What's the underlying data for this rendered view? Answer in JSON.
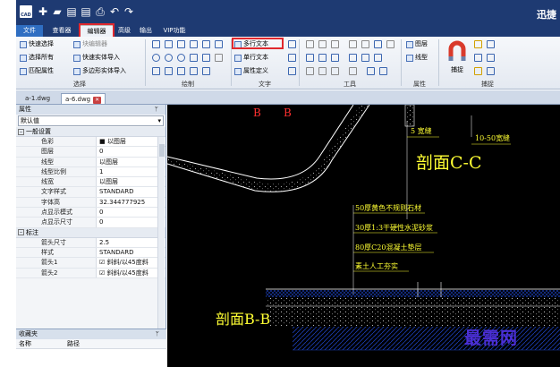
{
  "app": {
    "logo_text": "CAD",
    "brand": "迅捷"
  },
  "tabs": [
    {
      "label": "文件"
    },
    {
      "label": "查看器"
    },
    {
      "label": "编辑器"
    },
    {
      "label": "高级"
    },
    {
      "label": "输出"
    },
    {
      "label": "VIP功能"
    }
  ],
  "ribbon": {
    "select_group": {
      "label": "选择",
      "items": [
        "快速选择",
        "块编辑器",
        "选择所有",
        "快速实体导入",
        "匹配属性",
        "多边形实体导入"
      ]
    },
    "draw_group": {
      "label": "绘制"
    },
    "text_group": {
      "label": "文字",
      "items": [
        "多行文本",
        "单行文本",
        "属性定义"
      ]
    },
    "tools_group": {
      "label": "工具"
    },
    "props_group": {
      "label": "属性",
      "items": [
        "图层",
        "线型"
      ]
    },
    "snap_group": {
      "label": "捕捉",
      "button": "捕捉"
    }
  },
  "doc_tabs": [
    {
      "label": "a-1.dwg"
    },
    {
      "label": "a-6.dwg"
    }
  ],
  "properties": {
    "title": "属性",
    "pin": "ᛘ",
    "dropdown_value": "默认值",
    "sections": [
      {
        "title": "一般设置",
        "rows": [
          {
            "key": "色彩",
            "value": "■ 以图层"
          },
          {
            "key": "图层",
            "value": "0"
          },
          {
            "key": "线型",
            "value": "以图层"
          },
          {
            "key": "线型比例",
            "value": "1"
          },
          {
            "key": "线宽",
            "value": "以图层"
          },
          {
            "key": "文字样式",
            "value": "STANDARD"
          },
          {
            "key": "字体高",
            "value": "32.344777925"
          },
          {
            "key": "点显示模式",
            "value": "0"
          },
          {
            "key": "点显示尺寸",
            "value": "0"
          }
        ]
      },
      {
        "title": "标注",
        "rows": [
          {
            "key": "箭头尺寸",
            "value": "2.5"
          },
          {
            "key": "样式",
            "value": "STANDARD"
          },
          {
            "key": "箭头1",
            "value": "☑ 斜斜/以45度斜"
          },
          {
            "key": "箭头2",
            "value": "☑ 斜斜/以45度斜"
          }
        ]
      }
    ]
  },
  "favorites": {
    "title": "收藏夹",
    "columns": [
      "名称",
      "路径"
    ]
  },
  "drawing": {
    "labels": {
      "b1": "B",
      "b2": "B",
      "width_5": "5 宽缝",
      "width_10_50": "10-50宽缝",
      "section_cc": "剖面C-C",
      "layer1": "50厚黄色不规则石材",
      "layer2": "30厚1:3干硬性水泥砂浆",
      "layer3": "80厚C20混凝土垫层",
      "layer4": "素土人工夯实",
      "section_bb": "剖面B-B"
    },
    "watermark": "最需网"
  },
  "colors": {
    "titlebar": "#1e3a72",
    "highlight": "#e0282e",
    "cad_text": "#ffff33",
    "cad_red": "#ff3030",
    "canvas_bg": "#000000",
    "watermark": "#4b2fd6"
  }
}
